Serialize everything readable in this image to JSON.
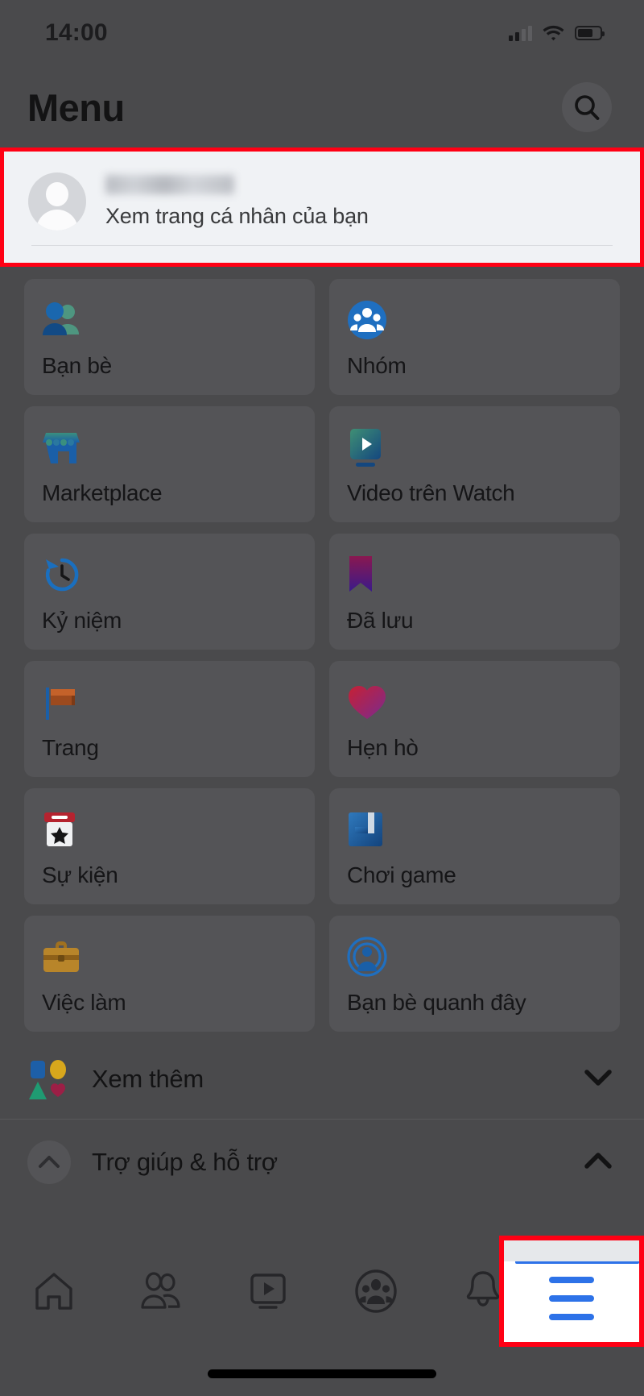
{
  "status_bar": {
    "time": "14:00",
    "icons": [
      "cellular-signal-icon",
      "wifi-icon",
      "battery-icon"
    ]
  },
  "header": {
    "title": "Menu",
    "search_icon": "search-icon"
  },
  "profile": {
    "name": "",
    "name_blurred": true,
    "subtitle": "Xem trang cá nhân của bạn",
    "avatar_icon": "default-avatar-icon",
    "highlight_color": "#ff0014"
  },
  "menu_grid": [
    {
      "label": "Bạn bè",
      "icon": "friends-icon"
    },
    {
      "label": "Nhóm",
      "icon": "groups-icon"
    },
    {
      "label": "Marketplace",
      "icon": "marketplace-icon"
    },
    {
      "label": "Video trên Watch",
      "icon": "watch-video-icon"
    },
    {
      "label": "Kỷ niệm",
      "icon": "memories-clock-icon"
    },
    {
      "label": "Đã lưu",
      "icon": "saved-bookmark-icon"
    },
    {
      "label": "Trang",
      "icon": "pages-flag-icon"
    },
    {
      "label": "Hẹn hò",
      "icon": "dating-heart-icon"
    },
    {
      "label": "Sự kiện",
      "icon": "events-calendar-icon"
    },
    {
      "label": "Chơi game",
      "icon": "gaming-icon"
    },
    {
      "label": "Việc làm",
      "icon": "jobs-briefcase-icon"
    },
    {
      "label": "Bạn bè quanh đây",
      "icon": "nearby-friends-icon"
    }
  ],
  "see_more": {
    "label": "Xem thêm",
    "icon": "shapes-icon",
    "chevron": "chevron-down-icon"
  },
  "help_section": {
    "label": "Trợ giúp & hỗ trợ",
    "icon": "help-circle-icon",
    "chevron": "chevron-up-icon"
  },
  "tab_bar": {
    "tabs": [
      {
        "name": "home-tab",
        "icon": "home-icon"
      },
      {
        "name": "friends-tab",
        "icon": "friends-outline-icon"
      },
      {
        "name": "watch-tab",
        "icon": "watch-play-icon"
      },
      {
        "name": "groups-tab",
        "icon": "groups-outline-icon"
      },
      {
        "name": "notifications-tab",
        "icon": "bell-icon"
      },
      {
        "name": "menu-tab",
        "icon": "hamburger-menu-icon"
      }
    ],
    "active_tab": "menu-tab",
    "active_color": "#2d72e8",
    "highlight_color": "#ff0014"
  }
}
